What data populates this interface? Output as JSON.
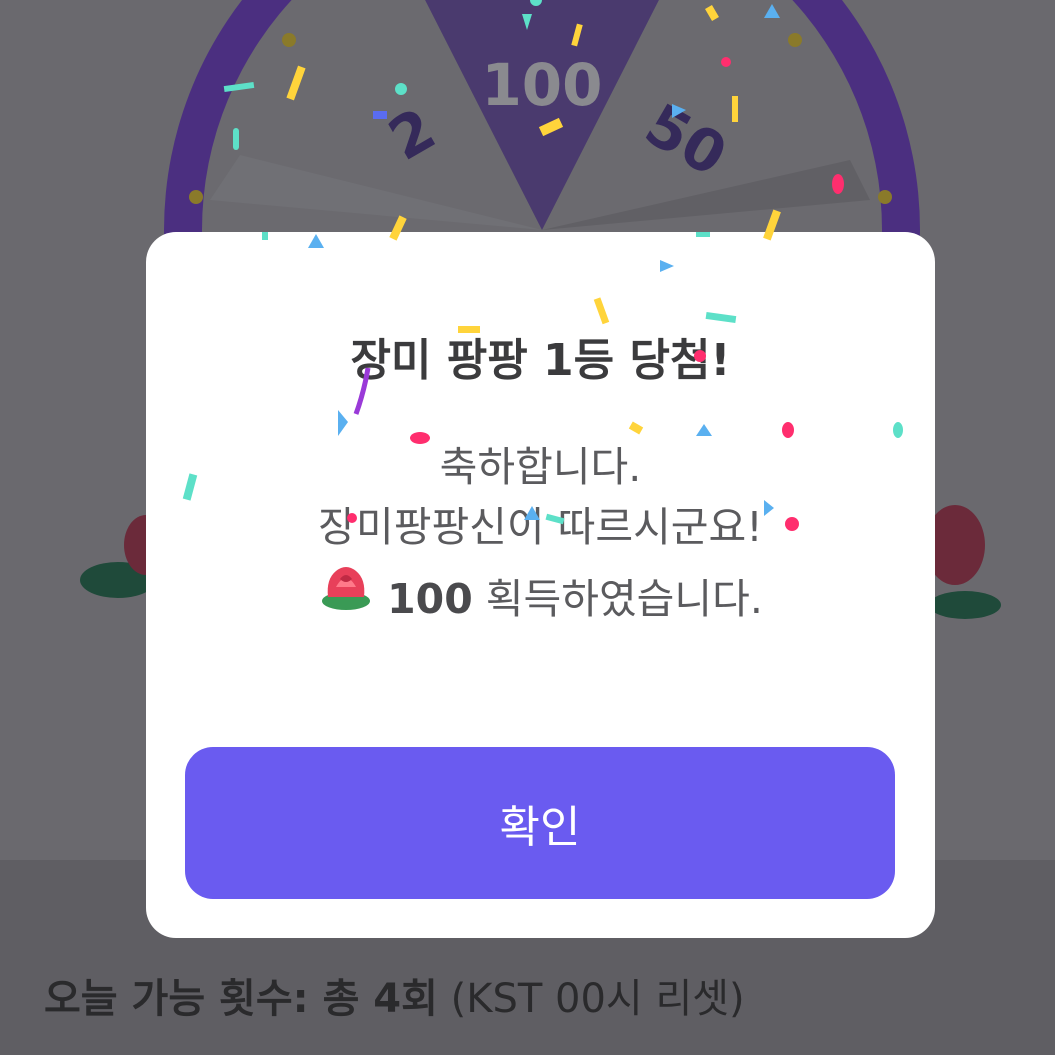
{
  "wheel": {
    "segment_labels": [
      "2",
      "100",
      "50"
    ]
  },
  "modal": {
    "title": "장미 팡팡 1등 당첨!",
    "message_line1": "축하합니다.",
    "message_line2": "장미팡팡신이 따르시군요!",
    "reward_amount": "100",
    "reward_suffix": "획득하였습니다.",
    "reward_icon": "rose-icon",
    "confirm_label": "확인"
  },
  "footer": {
    "label": "오늘 가능 횟수: 총 4회",
    "note": "(KST 00시 리셋)"
  },
  "colors": {
    "accent": "#6a5bf0",
    "wheel_rim": "#4b2f80",
    "wheel_highlight": "#4a3a6e"
  }
}
